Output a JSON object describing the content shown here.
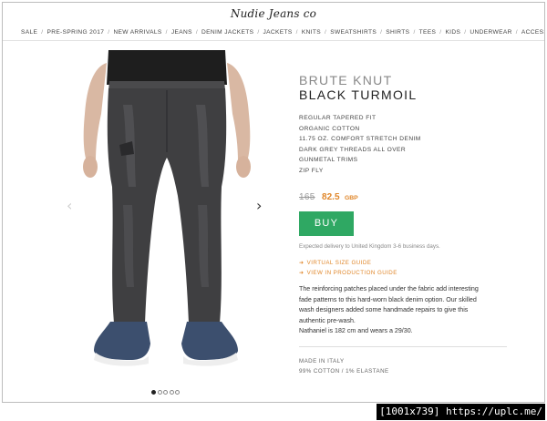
{
  "brand": {
    "logo_text": "Nudie Jeans co"
  },
  "nav": {
    "items": [
      "SALE",
      "PRE-SPRING 2017",
      "NEW ARRIVALS",
      "JEANS",
      "DENIM JACKETS",
      "JACKETS",
      "KNITS",
      "SWEATSHIRTS",
      "SHIRTS",
      "TEES",
      "KIDS",
      "UNDERWEAR",
      "ACCESSORIES"
    ],
    "separator": "/"
  },
  "gallery": {
    "prev_icon": "chevron-left-icon",
    "next_icon": "chevron-right-icon",
    "dots_count": 5,
    "active_dot": 0
  },
  "product": {
    "name_line1": "BRUTE KNUT",
    "name_line2": "BLACK TURMOIL",
    "features": [
      "REGULAR TAPERED FIT",
      "ORGANIC COTTON",
      "11.75 OZ. COMFORT STRETCH DENIM",
      "DARK GREY THREADS ALL OVER",
      "GUNMETAL TRIMS",
      "ZIP FLY"
    ],
    "price_old": "165",
    "price_new": "82.5",
    "currency": "GBP",
    "buy_label": "BUY",
    "delivery_note": "Expected delivery to United Kingdom 3-6 business days.",
    "links": [
      "VIRTUAL SIZE GUIDE",
      "VIEW IN PRODUCTION GUIDE"
    ],
    "description_lines": [
      "The reinforcing patches placed under the fabric add interesting",
      "fade patterns to this hard-worn black denim option. Our skilled",
      "wash designers added some handmade repairs to give this",
      "authentic pre-wash.",
      "Nathaniel is 182 cm and wears a 29/30."
    ],
    "origin": "MADE IN ITALY",
    "composition": "99% COTTON / 1% ELASTANE"
  },
  "watermark": {
    "text": "[1001x739] https://uplc.me/"
  },
  "colors": {
    "accent_orange": "#e0872b",
    "buy_green": "#2fa863",
    "jeans": "#3f3f41",
    "shirt": "#1e1e1e"
  }
}
